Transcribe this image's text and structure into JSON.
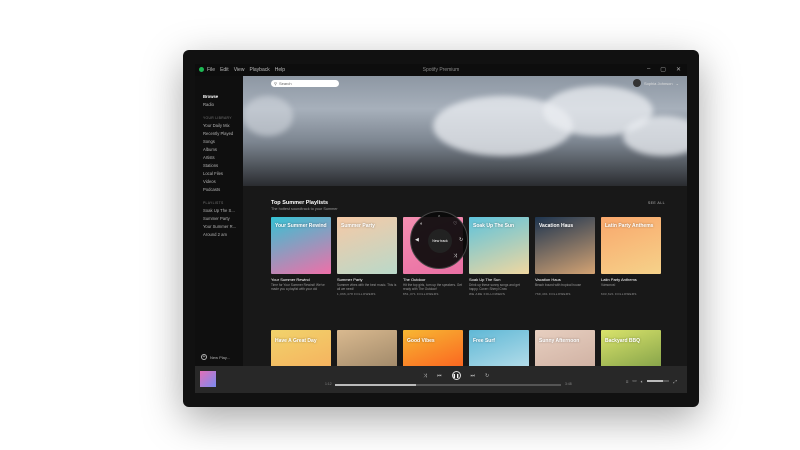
{
  "titlebar": {
    "menu": [
      "File",
      "Edit",
      "View",
      "Playback",
      "Help"
    ],
    "title": "Spotify Premium",
    "controls": [
      "–",
      "▢",
      "✕"
    ]
  },
  "sidebar": {
    "main_items": [
      "Browse",
      "Radio"
    ],
    "library_heading": "YOUR LIBRARY",
    "library_items": [
      "Your Daily Mix",
      "Recently Played",
      "Songs",
      "Albums",
      "Artists",
      "Stations",
      "Local Files",
      "Videos",
      "Podcasts"
    ],
    "playlists_heading": "PLAYLISTS",
    "playlist_items": [
      "Soak Up The S...",
      "Summer Party",
      "Your Summer R...",
      "Around 2 am"
    ],
    "new_playlist": "New Play..."
  },
  "header": {
    "search_placeholder": "Search",
    "user_name": "Sophia Johnson"
  },
  "section": {
    "title": "Top Summer Playlists",
    "subtitle": "The hottest soundtrack to your Summer",
    "see_all": "SEE ALL"
  },
  "cards_row1": [
    {
      "title": "Your Summer Rewind",
      "desc": "Time for Your Summer Rewind! We've made you a playlist with your old summer...",
      "followers": "",
      "cover_text": "Your Summer Rewind",
      "c1": "#35c3d4",
      "c2": "#f06fa8"
    },
    {
      "title": "Summer Party",
      "desc": "Summer vibes with the best music. This is all we need!",
      "followers": "1,066,478 FOLLOWERS",
      "cover_text": "Summer Party",
      "c1": "#f6c9a6",
      "c2": "#b9d9c9"
    },
    {
      "title": "The Outdoor",
      "desc": "Hit the top girls, turn up the speakers. Get ready with The Outdoor!",
      "followers": "851,371 FOLLOWERS",
      "cover_text": "",
      "c1": "#f48fb1",
      "c2": "#e96fa3"
    },
    {
      "title": "Soak Up The Sun",
      "desc": "Drink up these sunny songs and get happy. Cover: Sheryl Crow",
      "followers": "WE ARE FOLLOWERS",
      "cover_text": "Soak Up The Sun",
      "c1": "#5ec3dc",
      "c2": "#f0d7a0"
    },
    {
      "title": "Vacation Haus",
      "desc": "Beach bound with tropical house",
      "followers": "769,491 FOLLOWERS",
      "cover_text": "Vacation Haus",
      "c1": "#1e3550",
      "c2": "#d4a373"
    },
    {
      "title": "Latin Party Anthems",
      "desc": "Vámonos!",
      "followers": "603,621 FOLLOWERS",
      "cover_text": "Latin Party Anthems",
      "c1": "#f9a76c",
      "c2": "#f6d28a"
    }
  ],
  "cards_row2": [
    {
      "cover_text": "Have A Great Day",
      "c1": "#f1d36b",
      "c2": "#f7a85b"
    },
    {
      "cover_text": "",
      "c1": "#d9b98f",
      "c2": "#8f7a5e"
    },
    {
      "cover_text": "Good Vibes",
      "c1": "#f7b733",
      "c2": "#fc4a1a"
    },
    {
      "cover_text": "Free Surf",
      "c1": "#5fb8d6",
      "c2": "#cfe8ef"
    },
    {
      "cover_text": "Sunny Afternoon",
      "c1": "#e7cfc0",
      "c2": "#c9a89a"
    },
    {
      "cover_text": "Backyard BBQ",
      "c1": "#d9e36b",
      "c2": "#6b8f3f"
    }
  ],
  "radial_menu": {
    "label": "New track"
  },
  "player": {
    "time_elapsed": "1:12",
    "time_total": "3:48",
    "progress": 0.36,
    "volume": 0.7
  }
}
